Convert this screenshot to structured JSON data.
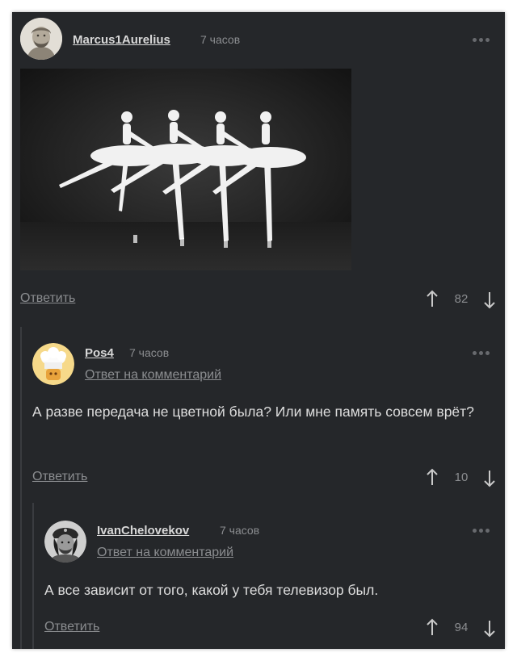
{
  "comments": [
    {
      "username": "Marcus1Aurelius",
      "time": "7 часов",
      "reply_label": "Ответить",
      "score": "82",
      "avatar_icon": "bust-portrait-avatar",
      "image_icon": "ballet-photo"
    },
    {
      "username": "Pos4",
      "time": "7 часов",
      "reply_to": "Ответ на комментарий",
      "text": "А разве передача не цветной была? Или мне память совсем врёт?",
      "reply_label": "Ответить",
      "score": "10",
      "avatar_icon": "chef-avatar"
    },
    {
      "username": "IvanChelovekov",
      "time": "7 часов",
      "reply_to": "Ответ на комментарий",
      "text": "А все зависит от того, какой у тебя телевизор был.",
      "reply_label": "Ответить",
      "score": "94",
      "avatar_icon": "che-portrait-avatar"
    }
  ],
  "colors": {
    "background": "#25272a",
    "text": "#dedede",
    "muted": "#8b8d90"
  }
}
